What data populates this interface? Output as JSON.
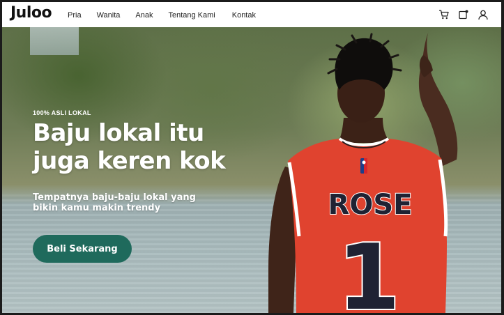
{
  "brand": {
    "logo": "Juloo"
  },
  "nav": {
    "links": [
      "Pria",
      "Wanita",
      "Anak",
      "Tentang Kami",
      "Kontak"
    ],
    "icons": [
      "cart-icon",
      "notification-icon",
      "user-icon"
    ]
  },
  "hero": {
    "eyebrow": "100% ASLI LOKAL",
    "headline_line1": "Baju lokal itu",
    "headline_line2": "juga keren kok",
    "subtext_line1": "Tempatnya baju-baju lokal yang",
    "subtext_line2": "bikin kamu makin trendy",
    "cta_label": "Beli Sekarang",
    "jersey_name": "ROSE",
    "jersey_number": "1"
  },
  "colors": {
    "accent": "#1f6a5c",
    "jersey": "#e0432f",
    "text": "#111111"
  }
}
